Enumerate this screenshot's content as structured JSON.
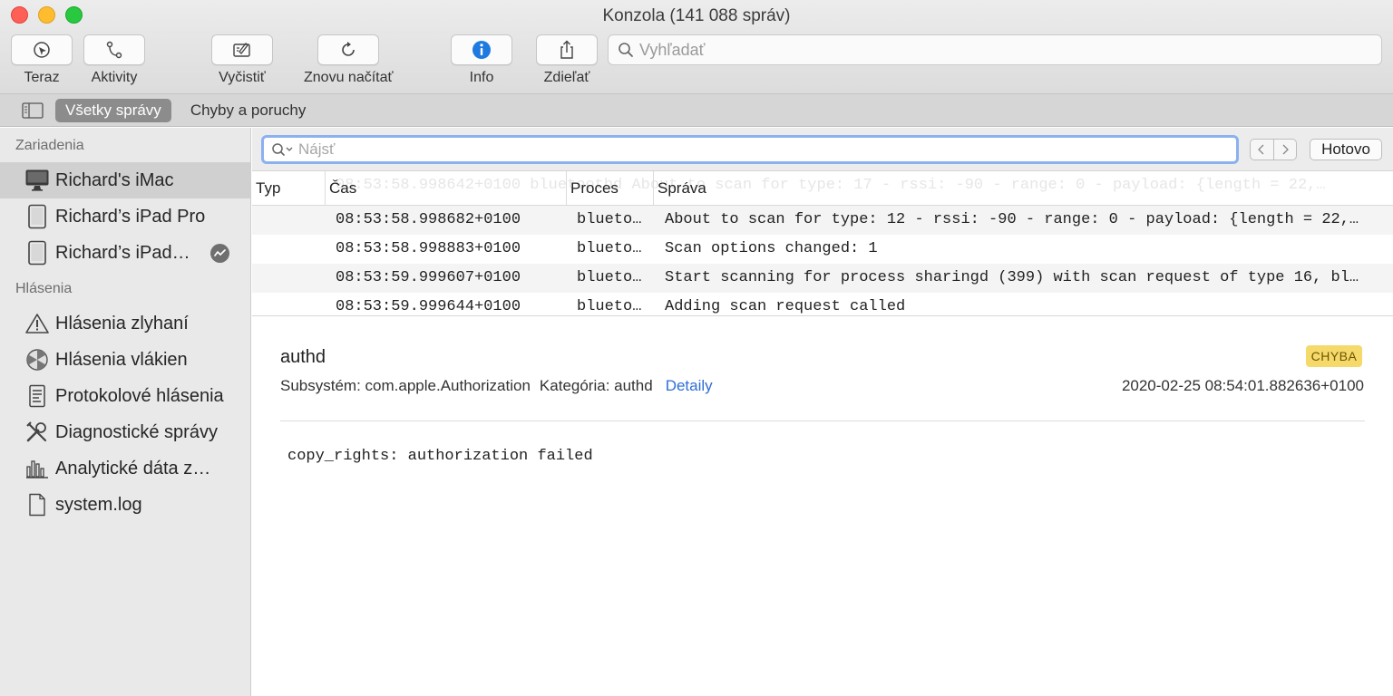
{
  "window": {
    "title": "Konzola (141 088 správ)"
  },
  "toolbar": {
    "now": "Teraz",
    "activities": "Aktivity",
    "clear": "Vyčistiť",
    "reload": "Znovu načítať",
    "info": "Info",
    "share": "Zdieľať",
    "search_placeholder": "Vyhľadať"
  },
  "filter": {
    "all_messages": "Všetky správy",
    "errors_faults": "Chyby a poruchy"
  },
  "sidebar": {
    "devices_header": "Zariadenia",
    "devices": [
      {
        "label": "Richard's iMac",
        "icon": "imac-icon",
        "selected": true
      },
      {
        "label": "Richard’s iPad Pro",
        "icon": "ipad-icon"
      },
      {
        "label": "Richard’s iPad…",
        "icon": "ipad-icon",
        "badge": "activity-icon"
      }
    ],
    "reports_header": "Hlásenia",
    "reports": [
      {
        "label": "Hlásenia zlyhaní",
        "icon": "warning-icon"
      },
      {
        "label": "Hlásenia vlákien",
        "icon": "spin-icon"
      },
      {
        "label": "Protokolové hlásenia",
        "icon": "log-report-icon"
      },
      {
        "label": "Diagnostické správy",
        "icon": "tools-icon"
      },
      {
        "label": "Analytické dáta z…",
        "icon": "bar-chart-icon"
      },
      {
        "label": "system.log",
        "icon": "document-icon"
      }
    ]
  },
  "findbar": {
    "placeholder": "Nájsť",
    "done": "Hotovo"
  },
  "table": {
    "headers": {
      "type": "Typ",
      "time": "Čas",
      "process": "Proces",
      "message": "Správa"
    },
    "ghost_row": "08:53:58.998642+0100        bluetoothd  About to scan for type: 17 - rssi: -90 - range: 0 - payload: {length = 22,…",
    "rows": [
      {
        "time": "08:53:58.998682+0100",
        "process": "blueto…",
        "message": "About to scan for type: 12 - rssi: -90 - range: 0 - payload: {length = 22,…"
      },
      {
        "time": "08:53:58.998883+0100",
        "process": "blueto…",
        "message": "Scan options changed: 1"
      },
      {
        "time": "08:53:59.999607+0100",
        "process": "blueto…",
        "message": "Start scanning for process sharingd (399) with scan request of type 16, bl…"
      },
      {
        "time": "08:53:59.999644+0100",
        "process": "blueto…",
        "message": "Adding scan request called"
      }
    ]
  },
  "detail": {
    "process": "authd",
    "subsystem": "Subsystém: com.apple.Authorization",
    "category": "Kategória: authd",
    "details_link": "Detaily",
    "badge": "CHYBA",
    "timestamp": "2020-02-25 08:54:01.882636+0100",
    "message": "copy_rights: authorization failed"
  },
  "colors": {
    "accent": "#2f6dd6",
    "error_badge": "#f6d96b",
    "info_blue": "#1f7ae0"
  }
}
